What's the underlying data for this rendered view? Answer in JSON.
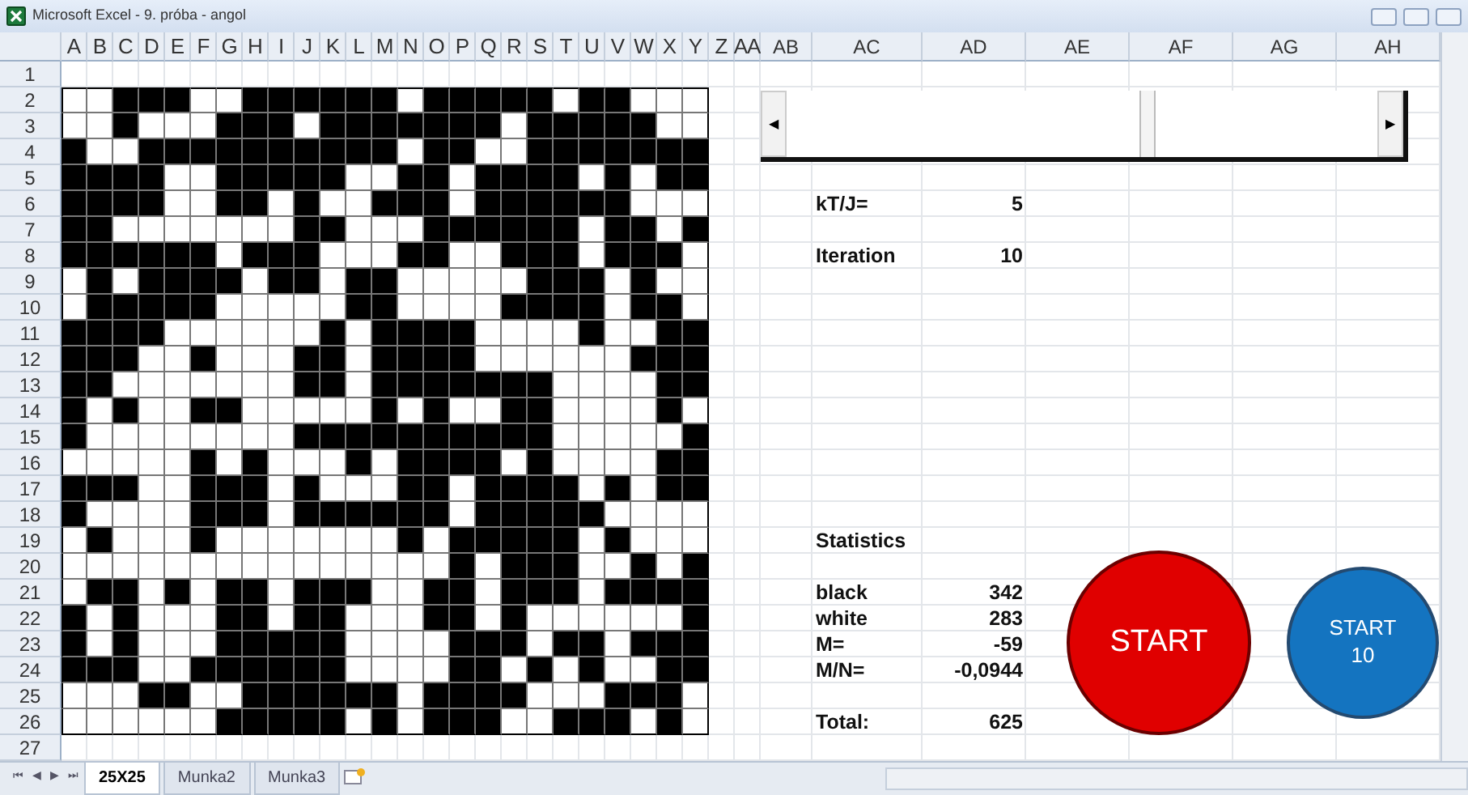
{
  "window": {
    "title": "Microsoft Excel - 9. próba - angol"
  },
  "columns": [
    "A",
    "B",
    "C",
    "D",
    "E",
    "F",
    "G",
    "H",
    "I",
    "J",
    "K",
    "L",
    "M",
    "N",
    "O",
    "P",
    "Q",
    "R",
    "S",
    "T",
    "U",
    "V",
    "W",
    "X",
    "Y",
    "Z",
    "AA",
    "AB",
    "AC",
    "AD",
    "AE",
    "AF",
    "AG",
    "AH"
  ],
  "row_numbers": [
    "1",
    "2",
    "3",
    "4",
    "5",
    "6",
    "7",
    "8",
    "9",
    "10",
    "11",
    "12",
    "13",
    "14",
    "15",
    "16",
    "17",
    "18",
    "19",
    "20",
    "21",
    "22",
    "23",
    "24",
    "25",
    "26",
    "27"
  ],
  "grid": {
    "rows": [
      {
        "black": [
          false,
          false,
          true,
          true,
          true,
          false,
          false,
          true,
          true,
          true,
          true,
          true,
          true,
          false,
          true,
          true,
          true,
          true,
          true,
          false,
          true,
          true,
          false,
          false,
          false
        ]
      },
      {
        "black": [
          false,
          false,
          true,
          false,
          false,
          false,
          true,
          true,
          true,
          false,
          true,
          true,
          true,
          true,
          true,
          true,
          true,
          false,
          true,
          true,
          true,
          true,
          true,
          false,
          false
        ]
      },
      {
        "black": [
          true,
          false,
          false,
          true,
          true,
          true,
          true,
          true,
          true,
          true,
          true,
          true,
          true,
          false,
          true,
          true,
          false,
          false,
          true,
          true,
          true,
          true,
          true,
          true,
          true
        ]
      },
      {
        "black": [
          true,
          true,
          true,
          true,
          false,
          false,
          true,
          true,
          true,
          true,
          true,
          false,
          false,
          true,
          true,
          false,
          true,
          true,
          true,
          true,
          false,
          true,
          false,
          true,
          true
        ]
      },
      {
        "black": [
          true,
          true,
          true,
          true,
          false,
          false,
          true,
          true,
          false,
          true,
          false,
          false,
          true,
          true,
          true,
          false,
          true,
          true,
          true,
          true,
          true,
          true,
          false,
          false,
          false
        ]
      },
      {
        "black": [
          true,
          true,
          false,
          false,
          false,
          false,
          false,
          false,
          false,
          true,
          true,
          false,
          false,
          false,
          true,
          true,
          true,
          true,
          true,
          true,
          false,
          true,
          true,
          false,
          true
        ]
      },
      {
        "black": [
          true,
          true,
          true,
          true,
          true,
          true,
          false,
          true,
          true,
          true,
          false,
          false,
          false,
          true,
          true,
          false,
          false,
          true,
          true,
          true,
          false,
          true,
          true,
          true,
          false
        ]
      },
      {
        "black": [
          false,
          true,
          false,
          true,
          true,
          true,
          true,
          false,
          true,
          true,
          false,
          true,
          true,
          false,
          false,
          false,
          false,
          false,
          true,
          true,
          true,
          false,
          true,
          false,
          false
        ]
      },
      {
        "black": [
          false,
          true,
          true,
          true,
          true,
          true,
          false,
          false,
          false,
          false,
          false,
          true,
          true,
          false,
          false,
          false,
          false,
          true,
          true,
          true,
          true,
          false,
          true,
          true,
          false
        ]
      },
      {
        "black": [
          true,
          true,
          true,
          true,
          false,
          false,
          false,
          false,
          false,
          false,
          true,
          false,
          true,
          true,
          true,
          true,
          false,
          false,
          false,
          false,
          true,
          false,
          false,
          true,
          true
        ]
      },
      {
        "black": [
          true,
          true,
          true,
          false,
          false,
          true,
          false,
          false,
          false,
          true,
          true,
          false,
          true,
          true,
          true,
          true,
          false,
          false,
          false,
          false,
          false,
          false,
          true,
          true,
          true
        ]
      },
      {
        "black": [
          true,
          true,
          false,
          false,
          false,
          false,
          false,
          false,
          false,
          true,
          true,
          false,
          true,
          true,
          true,
          true,
          true,
          true,
          true,
          false,
          false,
          false,
          false,
          true,
          true
        ]
      },
      {
        "black": [
          true,
          false,
          true,
          false,
          false,
          true,
          true,
          false,
          false,
          false,
          false,
          false,
          true,
          false,
          true,
          false,
          false,
          true,
          true,
          false,
          false,
          false,
          false,
          true,
          false
        ]
      },
      {
        "black": [
          true,
          false,
          false,
          false,
          false,
          false,
          false,
          false,
          false,
          true,
          true,
          true,
          true,
          true,
          true,
          true,
          true,
          true,
          true,
          false,
          false,
          false,
          false,
          false,
          true
        ]
      },
      {
        "black": [
          false,
          false,
          false,
          false,
          false,
          true,
          false,
          true,
          false,
          false,
          false,
          true,
          false,
          true,
          true,
          true,
          true,
          false,
          true,
          false,
          false,
          false,
          false,
          true,
          true
        ]
      },
      {
        "black": [
          true,
          true,
          true,
          false,
          false,
          true,
          true,
          true,
          false,
          true,
          false,
          false,
          false,
          true,
          true,
          false,
          true,
          true,
          true,
          true,
          false,
          true,
          false,
          true,
          true
        ]
      },
      {
        "black": [
          true,
          false,
          false,
          false,
          false,
          true,
          true,
          true,
          false,
          true,
          true,
          true,
          true,
          true,
          true,
          false,
          true,
          true,
          true,
          true,
          true,
          false,
          false,
          false,
          false
        ]
      },
      {
        "black": [
          false,
          true,
          false,
          false,
          false,
          true,
          false,
          false,
          false,
          false,
          false,
          false,
          false,
          true,
          false,
          true,
          true,
          true,
          true,
          true,
          false,
          true,
          false,
          false,
          false
        ]
      },
      {
        "black": [
          false,
          false,
          false,
          false,
          false,
          false,
          false,
          false,
          false,
          false,
          false,
          false,
          false,
          false,
          false,
          true,
          false,
          true,
          true,
          true,
          false,
          false,
          true,
          false,
          true
        ]
      },
      {
        "black": [
          false,
          true,
          true,
          false,
          true,
          false,
          true,
          true,
          false,
          true,
          true,
          true,
          false,
          false,
          true,
          true,
          false,
          true,
          true,
          true,
          false,
          true,
          true,
          true,
          true
        ]
      },
      {
        "black": [
          true,
          false,
          true,
          false,
          false,
          false,
          true,
          true,
          false,
          true,
          true,
          false,
          false,
          false,
          true,
          true,
          false,
          true,
          false,
          false,
          false,
          false,
          false,
          false,
          true
        ]
      },
      {
        "black": [
          true,
          false,
          true,
          false,
          false,
          false,
          true,
          true,
          true,
          true,
          true,
          false,
          false,
          false,
          false,
          true,
          true,
          true,
          false,
          true,
          true,
          false,
          true,
          true,
          true
        ]
      },
      {
        "black": [
          true,
          true,
          true,
          false,
          false,
          true,
          true,
          true,
          true,
          true,
          true,
          false,
          false,
          false,
          false,
          true,
          true,
          false,
          true,
          false,
          true,
          false,
          false,
          true,
          true
        ]
      },
      {
        "black": [
          false,
          false,
          false,
          true,
          true,
          false,
          false,
          true,
          true,
          true,
          true,
          true,
          true,
          false,
          true,
          true,
          true,
          true,
          false,
          false,
          false,
          true,
          true,
          true,
          false
        ]
      },
      {
        "black": [
          false,
          false,
          false,
          false,
          false,
          false,
          true,
          true,
          true,
          true,
          true,
          false,
          true,
          false,
          true,
          true,
          true,
          false,
          false,
          true,
          true,
          true,
          false,
          true,
          false
        ]
      }
    ]
  },
  "scroll_control": {
    "arrows": [
      "◀",
      "▶"
    ]
  },
  "sheet_nav": [
    "⏮",
    "◀",
    "▶",
    "⏭"
  ],
  "parameters": [
    {
      "label": "kT/J=",
      "value": "5"
    },
    {
      "label": "Iteration",
      "value": "10"
    }
  ],
  "statistics": {
    "title": "Statistics",
    "rows": [
      {
        "label": "black",
        "value": "342"
      },
      {
        "label": "white",
        "value": "283"
      },
      {
        "label": "M=",
        "value": "-59"
      },
      {
        "label": "M/N=",
        "value": "-0,0944"
      }
    ],
    "total": {
      "label": "Total:",
      "value": "625"
    }
  },
  "buttons": [
    {
      "kind": "red",
      "label": "START"
    },
    {
      "kind": "blue",
      "label": "START\n10"
    }
  ],
  "sheet_tabs": [
    {
      "label": "25X25",
      "selected": true
    },
    {
      "label": "Munka2",
      "selected": false
    },
    {
      "label": "Munka3",
      "selected": false
    }
  ]
}
